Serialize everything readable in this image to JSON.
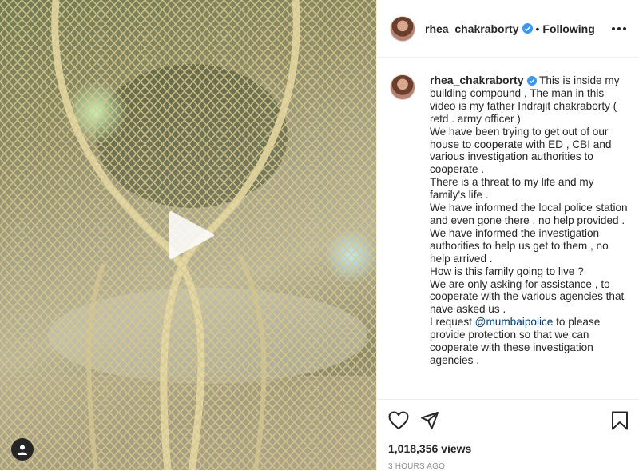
{
  "post": {
    "username": "rhea_chakraborty",
    "follow_separator": "•",
    "follow_label": "Following",
    "caption_lines": [
      "This is inside my building compound , The man in this video is my father Indrajit chakraborty ( retd . army officer )",
      "We have been trying to get out of our house to cooperate with ED , CBI and various investigation authorities to cooperate .",
      "There is a threat to my life and my family's life .",
      "We have informed the local police station and even gone there , no help provided . We have informed the investigation authorities to help us get to them , no help arrived .",
      "How is this family going to live ?",
      "We are only asking for assistance , to cooperate with the various agencies that have asked us ."
    ],
    "last_line_prefix": "I request ",
    "mention": "@mumbaipolice",
    "last_line_suffix": " to please provide protection so that we can cooperate with these investigation agencies .",
    "views": "1,018,356 views",
    "time_ago": "3 HOURS AGO"
  },
  "icons": {
    "like": "heart-icon",
    "share": "paper-plane-icon",
    "save": "bookmark-icon",
    "more": "more-horizontal-icon",
    "play": "play-icon",
    "user_tag": "user-tag-icon",
    "verified": "verified-badge-icon"
  },
  "colors": {
    "verified": "#3897f0",
    "mention": "#00376b",
    "text": "#262626",
    "muted": "#8e8e8e"
  }
}
